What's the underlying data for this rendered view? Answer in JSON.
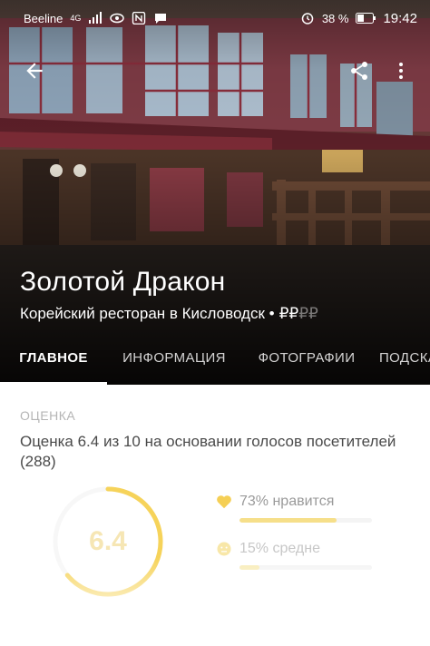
{
  "status_bar": {
    "carrier": "Beeline",
    "network": "4G",
    "battery": "38 %",
    "time": "19:42",
    "icons": [
      "signal-icon",
      "eye-icon",
      "nfc-icon",
      "chat-icon",
      "alarm-icon",
      "battery-icon"
    ]
  },
  "app_bar": {
    "back_icon": "arrow-left-icon",
    "share_icon": "share-icon",
    "more_icon": "more-vertical-icon"
  },
  "venue": {
    "name": "Золотой Дракон",
    "category_line": "Корейский ресторан в Кисловодск •",
    "price_active": "₽₽",
    "price_inactive": "₽₽"
  },
  "tabs": [
    {
      "label": "ГЛАВНОЕ",
      "active": true
    },
    {
      "label": "ИНФОРМАЦИЯ",
      "active": false
    },
    {
      "label": "ФОТОГРАФИИ",
      "active": false
    },
    {
      "label": "ПОДСКАЗКИ",
      "active": false
    }
  ],
  "rating": {
    "section_label": "ОЦЕНКА",
    "description": "Оценка 6.4 из 10 на основании голосов посетителей (288)",
    "score": "6.4",
    "score_value": 6.4,
    "score_max": 10,
    "accent_color": "#f6d35a",
    "metrics": [
      {
        "label": "73% нравится",
        "icon": "heart-icon",
        "value": 0.73,
        "color": "#f6df8a"
      },
      {
        "label": "15% средне",
        "icon": "neutral-face-icon",
        "value": 0.15,
        "color": "#f8ecb8"
      }
    ]
  }
}
